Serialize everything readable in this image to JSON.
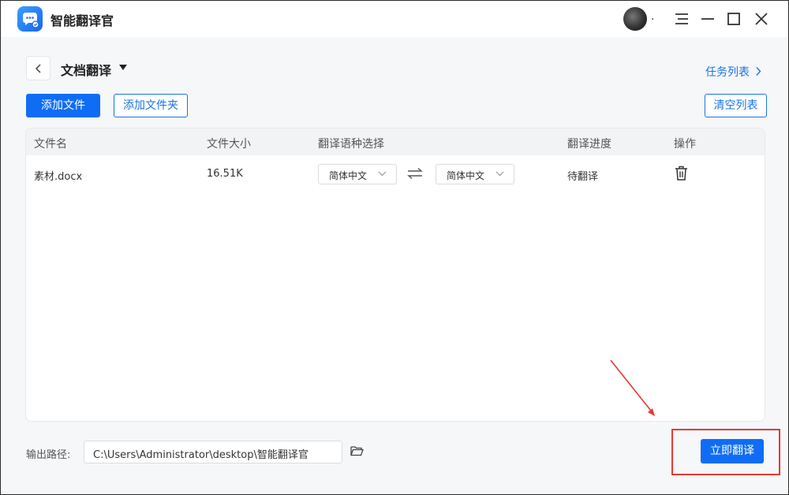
{
  "app": {
    "title": "智能翻译官",
    "avatar_suffix": "."
  },
  "header": {
    "page_title": "文档翻译",
    "task_list_label": "任务列表"
  },
  "toolbar": {
    "add_file_label": "添加文件",
    "add_folder_label": "添加文件夹",
    "clear_list_label": "清空列表"
  },
  "table": {
    "columns": [
      "文件名",
      "文件大小",
      "翻译语种选择",
      "翻译进度",
      "操作"
    ],
    "rows": [
      {
        "file_name": "素材.docx",
        "file_size": "16.51K",
        "source_lang": "简体中文",
        "target_lang": "简体中文",
        "progress": "待翻译"
      }
    ]
  },
  "footer": {
    "output_label": "输出路径:",
    "output_path": "C:\\Users\\Administrator\\desktop\\智能翻译官",
    "translate_button_label": "立即翻译"
  },
  "colors": {
    "accent": "#0f6df5",
    "annotation_red": "#e53935"
  },
  "icons": [
    "app-logo-icon",
    "avatar",
    "menu-icon",
    "minimize-icon",
    "maximize-icon",
    "close-icon",
    "back-icon",
    "caret-down-icon",
    "chevron-right-icon",
    "swap-icon",
    "trash-icon",
    "folder-icon"
  ]
}
